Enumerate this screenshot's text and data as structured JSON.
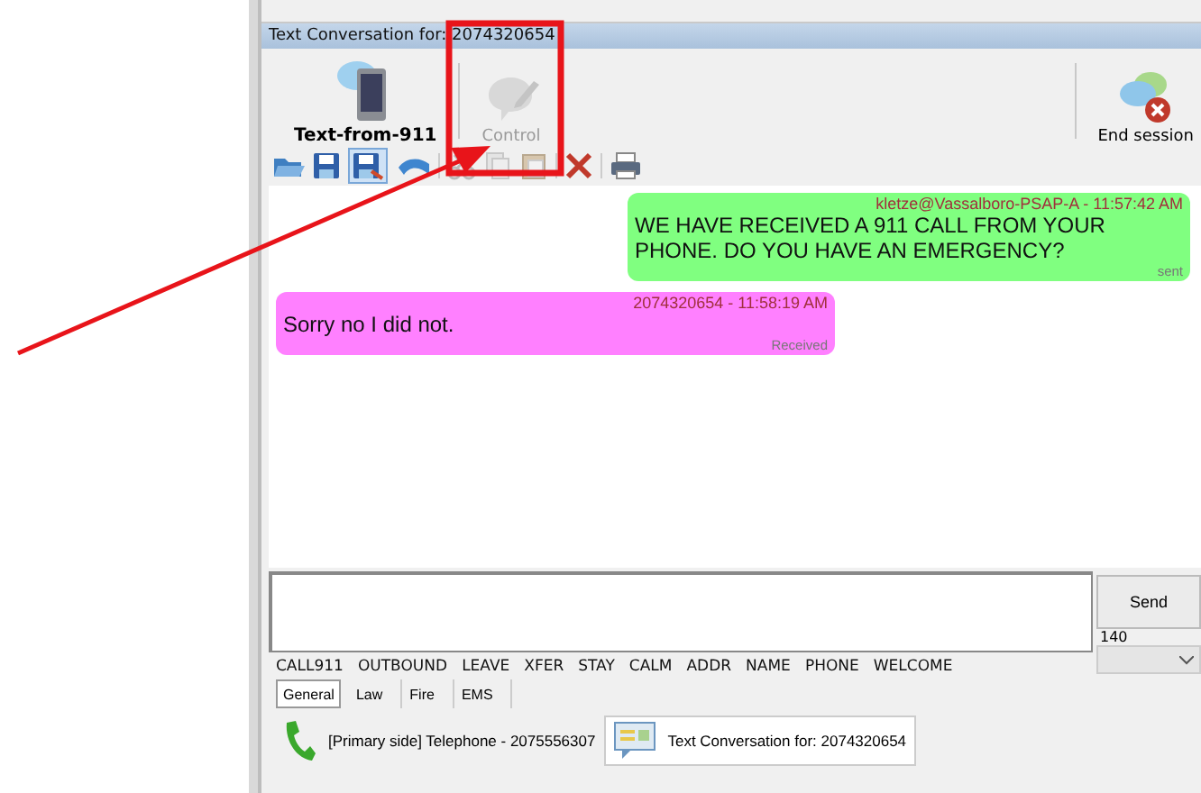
{
  "window": {
    "title": "Text Conversation for: 2074320654"
  },
  "toolbar": {
    "buttons": [
      {
        "kind": "phone",
        "label": "Text-from-911",
        "disabled": false
      },
      {
        "kind": "compose",
        "label": "Control",
        "disabled": true
      },
      {
        "kind": "end",
        "label": "End session",
        "disabled": false
      }
    ]
  },
  "messages": [
    {
      "kind": "sent",
      "header": "kletze@Vassalboro-PSAP-A - 11:57:42 AM",
      "text": "WE HAVE RECEIVED A 911 CALL FROM YOUR PHONE. DO YOU HAVE AN EMERGENCY?",
      "status": "sent"
    },
    {
      "kind": "received",
      "header": "2074320654 - 11:58:19 AM",
      "text": "Sorry no I did not.",
      "status": "Received"
    }
  ],
  "composer": {
    "send_label": "Send",
    "counter": "140"
  },
  "quick_texts": [
    "CALL911",
    "OUTBOUND",
    "LEAVE",
    "XFER",
    "STAY",
    "CALM",
    "ADDR",
    "NAME",
    "PHONE",
    "WELCOME"
  ],
  "category_tabs": [
    {
      "label": "General",
      "selected": true
    },
    {
      "label": "Law",
      "selected": false
    },
    {
      "label": "Fire",
      "selected": false
    },
    {
      "label": "EMS",
      "selected": false
    }
  ],
  "session_tabs": [
    {
      "kind": "phone",
      "label": "[Primary side] Telephone - 2075556307",
      "selected": false
    },
    {
      "kind": "text",
      "label": "Text Conversation for: 2074320654",
      "selected": true
    }
  ]
}
